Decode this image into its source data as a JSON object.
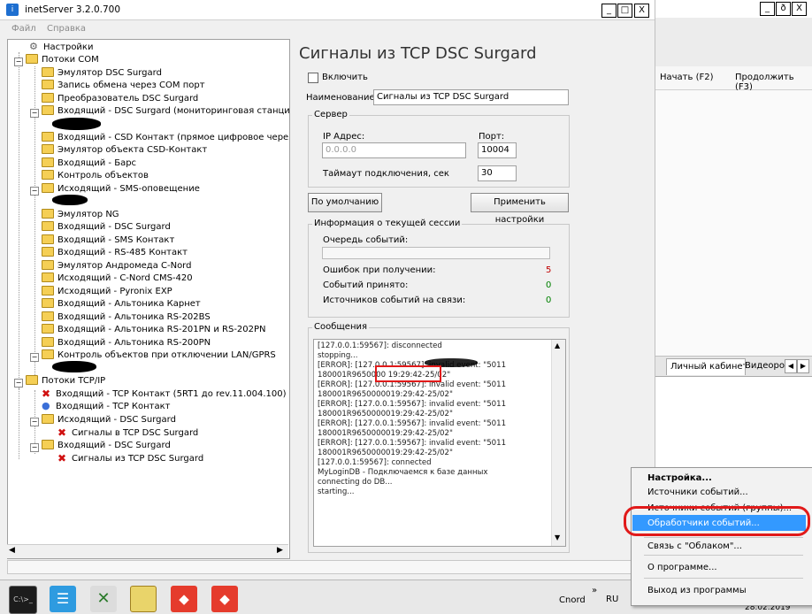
{
  "window": {
    "title": "inetServer 3.2.0.700",
    "controls": {
      "minimize": "_",
      "maximize": "□",
      "close": "X"
    }
  },
  "menu": {
    "file": "Файл",
    "help": "Справка"
  },
  "tree": {
    "items": [
      {
        "label": "Настройки"
      },
      {
        "label": "Потоки COM"
      },
      {
        "label": "Эмулятор DSC Surgard"
      },
      {
        "label": "Запись обмена через COM порт"
      },
      {
        "label": "Преобразователь DSC Surgard"
      },
      {
        "label": "Входящий - DSC Surgard (мониторинговая станция \"Конт"
      },
      {
        "label": "Входящий - CSD Контакт (прямое цифровое через модем"
      },
      {
        "label": "Эмулятор объекта CSD-Контакт"
      },
      {
        "label": "Входящий - Барс"
      },
      {
        "label": "Контроль объектов"
      },
      {
        "label": "Исходящий - SMS-оповещение"
      },
      {
        "label": "Эмулятор NG"
      },
      {
        "label": "Входящий - DSC Surgard"
      },
      {
        "label": "Входящий - SMS Контакт"
      },
      {
        "label": "Входящий - RS-485 Контакт"
      },
      {
        "label": "Эмулятор Андромеда C-Nord"
      },
      {
        "label": "Исходящий - C-Nord CMS-420"
      },
      {
        "label": "Исходящий - Pyronix EXP"
      },
      {
        "label": "Входящий - Альтоника Карнет"
      },
      {
        "label": "Входящий - Альтоника RS-202BS"
      },
      {
        "label": "Входящий - Альтоника RS-201PN и RS-202PN"
      },
      {
        "label": "Входящий - Альтоника RS-200PN"
      },
      {
        "label": "Контроль объектов при отключении LAN/GPRS"
      },
      {
        "label": "Потоки TCP/IP"
      },
      {
        "label": "Входящий - TCP Контакт (5RT1 до rev.11.004.100)"
      },
      {
        "label": "Входящий - TCP Контакт"
      },
      {
        "label": "Исходящий - DSC Surgard"
      },
      {
        "label": "Сигналы в TCP DSC Surgard"
      },
      {
        "label": "Входящий - DSC Surgard"
      },
      {
        "label": "Сигналы из TCP DSC Surgard"
      }
    ]
  },
  "panel": {
    "heading": "Сигналы из TCP DSC Surgard",
    "enable_label": "Включить",
    "name_label": "Наименование:",
    "name_value": "Сигналы из TCP DSC Surgard",
    "server_group": "Сервер",
    "ip_label": "IP Адрес:",
    "ip_placeholder": "0.0.0.0",
    "port_label": "Порт:",
    "port_value": "10004",
    "timeout_label": "Таймаут подключения, сек",
    "timeout_value": "30",
    "defaults_button": "По умолчанию",
    "apply_button": "Применить настройки",
    "session_group": "Информация о текущей сессии",
    "queue_label": "Очередь событий:",
    "errors_label": "Ошибок при получении:",
    "errors_value": "5",
    "accepted_label": "Событий принято:",
    "accepted_value": "0",
    "sources_label": "Источников событий на связи:",
    "sources_value": "0",
    "messages_group": "Сообщения",
    "messages": [
      "[127.0.0.1:59567]: disconnected",
      "stopping...",
      "[ERROR]: [127.0.0.1:59567]: invalid event: \"5011",
      "180001R9650000 19:29:42-25/02\"",
      "[ERROR]: [127.0.0.1:59567]: invalid event: \"5011",
      "180001R9650000019:29:42-25/02\"",
      "[ERROR]: [127.0.0.1:59567]: invalid event: \"5011",
      "180001R9650000019:29:42-25/02\"",
      "[ERROR]: [127.0.0.1:59567]: invalid event: \"5011",
      "180001R9650000019:29:42-25/02\"",
      "[ERROR]: [127.0.0.1:59567]: invalid event: \"5011",
      "180001R9650000019:29:42-25/02\"",
      "[127.0.0.1:59567]: connected",
      "MyLoginDB - Подключаемся к базе данных",
      "connecting do DB...",
      "starting..."
    ]
  },
  "background_window": {
    "controls": {
      "minimize": "_",
      "maximize": "ð",
      "close": "X"
    },
    "start_button": "Начать (F2)",
    "continue_button": "Продолжить (F3)",
    "tab_cabinet": "Личный кабинет",
    "tab_video": "Видеоро"
  },
  "context_menu": {
    "items": [
      "Настройка...",
      "Источники событий...",
      "Источники событий (группы)...",
      "Обработчики событий...",
      "Связь с \"Облаком\"...",
      "О программе...",
      "Выход из программы"
    ]
  },
  "taskbar": {
    "lang_label": "Cnord",
    "lang_code": "RU",
    "date": "28.02.2019",
    "chevron": "»"
  },
  "colors": {
    "highlight": "#3399ff",
    "annotation": "#e11a1a",
    "error_count": "#c00000",
    "ok_count": "#008000"
  }
}
